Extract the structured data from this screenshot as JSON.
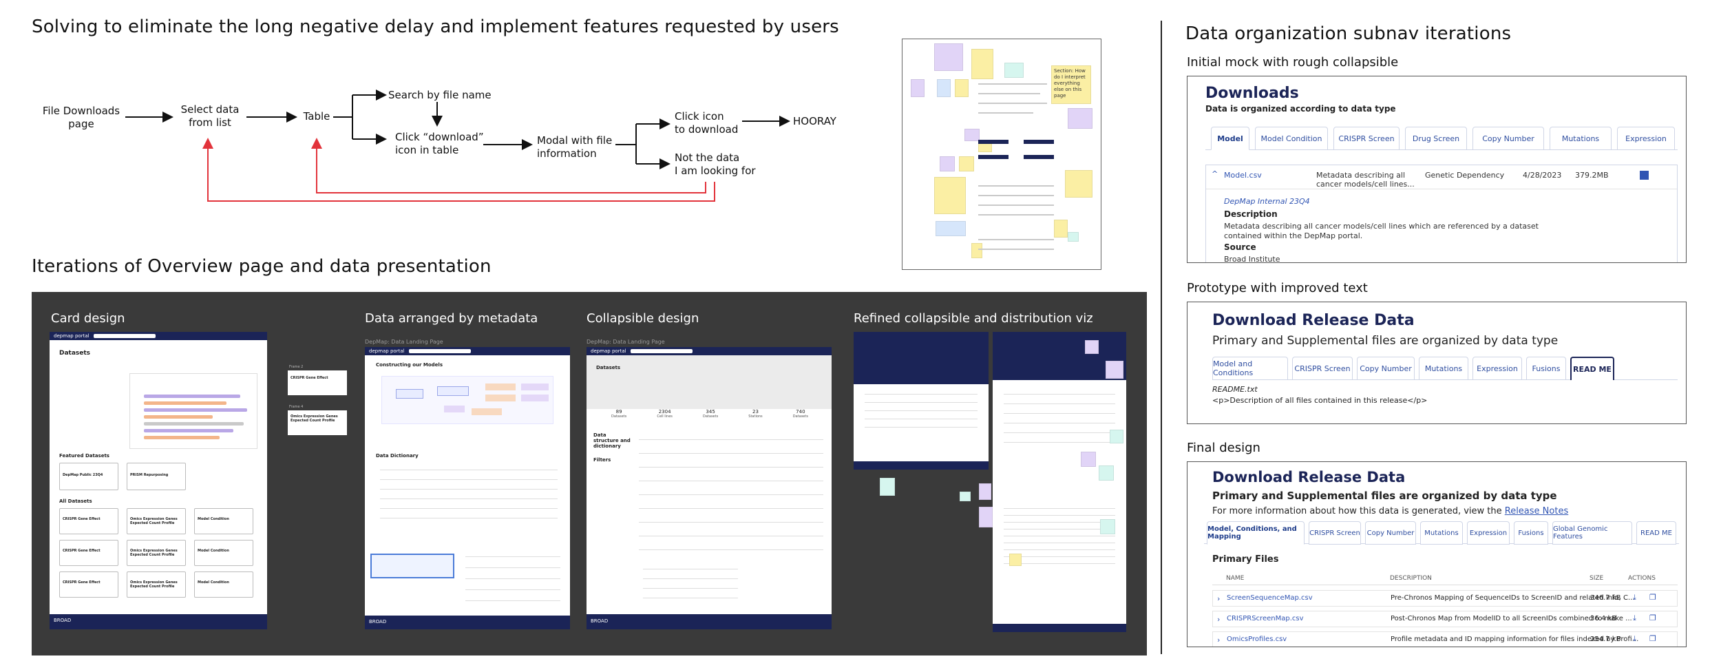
{
  "left": {
    "heading1": "Solving to eliminate the long negative delay and implement features requested by users",
    "flow": {
      "n1": "File Downloads\npage",
      "n2": "Select data\nfrom list",
      "n3": "Table",
      "n4": "Search by file name",
      "n5": "Click “download”\nicon in table",
      "n6": "Modal with file\ninformation",
      "n7": "Click icon\nto download",
      "n8": "Not the data\nI am looking for",
      "n9": "HOORAY"
    },
    "heading2": "Iterations of Overview page and data presentation",
    "frames": {
      "card": "Card design",
      "meta": "Data arranged by metadata",
      "collapsible": "Collapsible design",
      "refined": "Refined collapsible and distribution viz"
    },
    "card_mock": {
      "title": "Datasets",
      "featured": "Featured Datasets",
      "all": "All Datasets",
      "card1": "DepMap Public 23Q4",
      "card2": "PRISM Repurposing",
      "c_a": "CRISPR Gene Effect",
      "c_b": "Omics Expression Genes Expected Count Profile",
      "c_c": "Model Condition",
      "frame2": "Frame 2",
      "frame4": "Frame 4",
      "f2_title": "CRISPR Gene Effect",
      "f4_title": "Omics Expression Genes Expected Count Profile",
      "logo": "depmap portal",
      "broad": "BROAD"
    },
    "meta_mock": {
      "label": "DepMap: Data Landing Page",
      "section": "Constructing our Models",
      "dict": "Data Dictionary",
      "logo": "depmap portal",
      "broad": "BROAD"
    },
    "collapse_mock": {
      "label": "DepMap: Data Landing Page",
      "title": "Datasets",
      "stats": [
        {
          "num": "89",
          "label": "Datasets"
        },
        {
          "num": "2304",
          "label": "Cell lines"
        },
        {
          "num": "345",
          "label": "Datasets"
        },
        {
          "num": "23",
          "label": "Stations"
        },
        {
          "num": "740",
          "label": "Datasets"
        }
      ],
      "structure": "Data structure and dictionary",
      "filters": "Filters",
      "logo": "depmap portal",
      "broad": "BROAD"
    },
    "notes_section": "Section: How do I interpret everything else on this page"
  },
  "right": {
    "heading": "Data organization subnav iterations",
    "mock1": {
      "label": "Initial mock with rough collapsible",
      "title": "Downloads",
      "subtitle": "Data is organized according to data type",
      "tabs": [
        "Model",
        "Model Condition",
        "CRISPR Screen",
        "Drug Screen",
        "Copy Number",
        "Mutations",
        "Expression"
      ],
      "row": {
        "file": "Model.csv",
        "desc": "Metadata describing all cancer models/cell lines...",
        "type": "Genetic Dependency",
        "date": "4/28/2023",
        "size": "379.2MB"
      },
      "release": "DepMap Internal 23Q4",
      "desc_label": "Description",
      "desc_text": "Metadata describing all cancer models/cell lines which are referenced by a dataset contained within the DepMap portal.",
      "source_label": "Source",
      "source_text": "Broad Institute"
    },
    "mock2": {
      "label": "Prototype with improved text",
      "title": "Download Release Data",
      "subtitle": "Primary and Supplemental files are organized by data type",
      "tabs": [
        "Model and Conditions",
        "CRISPR Screen",
        "Copy Number",
        "Mutations",
        "Expression",
        "Fusions",
        "READ ME"
      ],
      "readme_file": "README.txt",
      "readme_text": "<p>Description of all files contained in this release</p>"
    },
    "mock3": {
      "label": "Final design",
      "title": "Download Release Data",
      "subtitle": "Primary and Supplemental files are organized by data type",
      "info_prefix": "For more information about how this data is generated, view the",
      "info_link": "Release Notes",
      "tabs": [
        "Model, Conditions, and Mapping",
        "CRISPR Screen",
        "Copy Number",
        "Mutations",
        "Expression",
        "Fusions",
        "Global Genomic Features",
        "READ ME"
      ],
      "section": "Primary Files",
      "columns": [
        "NAME",
        "DESCRIPTION",
        "SIZE",
        "ACTIONS"
      ],
      "rows": [
        {
          "name": "ScreenSequenceMap.csv",
          "desc": "Pre-Chronos Mapping of SequenceIDs to ScreenID and related info, C...",
          "size": "346.7 kB"
        },
        {
          "name": "CRISPRScreenMap.csv",
          "desc": "Post-Chronos Map from ModelID to all ScreenIDs combined to make ...",
          "size": "36.4 kB"
        },
        {
          "name": "OmicsProfiles.csv",
          "desc": "Profile metadata and ID mapping information for files indexed by Profi...",
          "size": "254.7 kB"
        }
      ]
    }
  },
  "colors": {
    "navy": "#1b2457",
    "link_blue": "#3155b3",
    "arrow_red": "#e2333b",
    "panel_dark": "#3a3a3a"
  }
}
